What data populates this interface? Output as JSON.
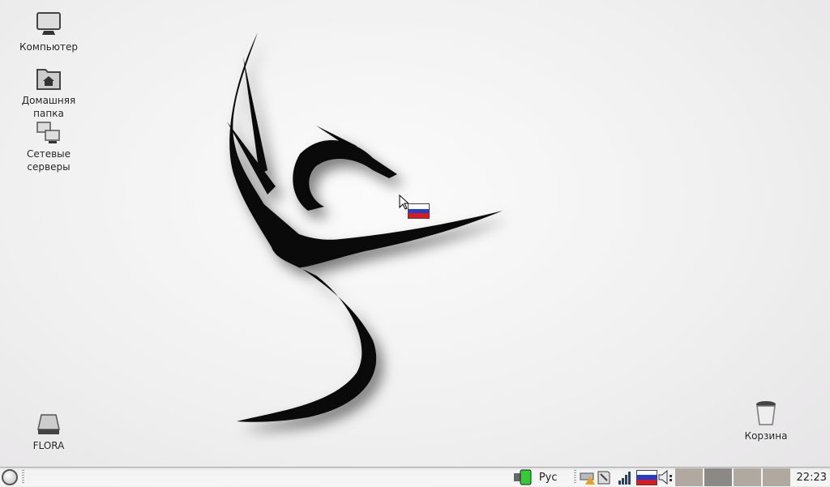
{
  "desktop": {
    "icons": [
      {
        "label": "Компьютер",
        "icon": "computer-icon"
      },
      {
        "label": "Домашняя папка",
        "icon": "home-folder-icon"
      },
      {
        "label": "Сетевые серверы",
        "icon": "network-icon"
      },
      {
        "label": "FLORA",
        "icon": "drive-icon"
      },
      {
        "label": "Корзина",
        "icon": "trash-icon"
      }
    ]
  },
  "taskbar": {
    "keyboard_layout": "Рус",
    "clock": "22:23",
    "workspaces": 4,
    "active_workspace": 2,
    "colors": {
      "flag_white": "#ffffff",
      "flag_blue": "#1e3fd0",
      "flag_red": "#e01818"
    }
  }
}
